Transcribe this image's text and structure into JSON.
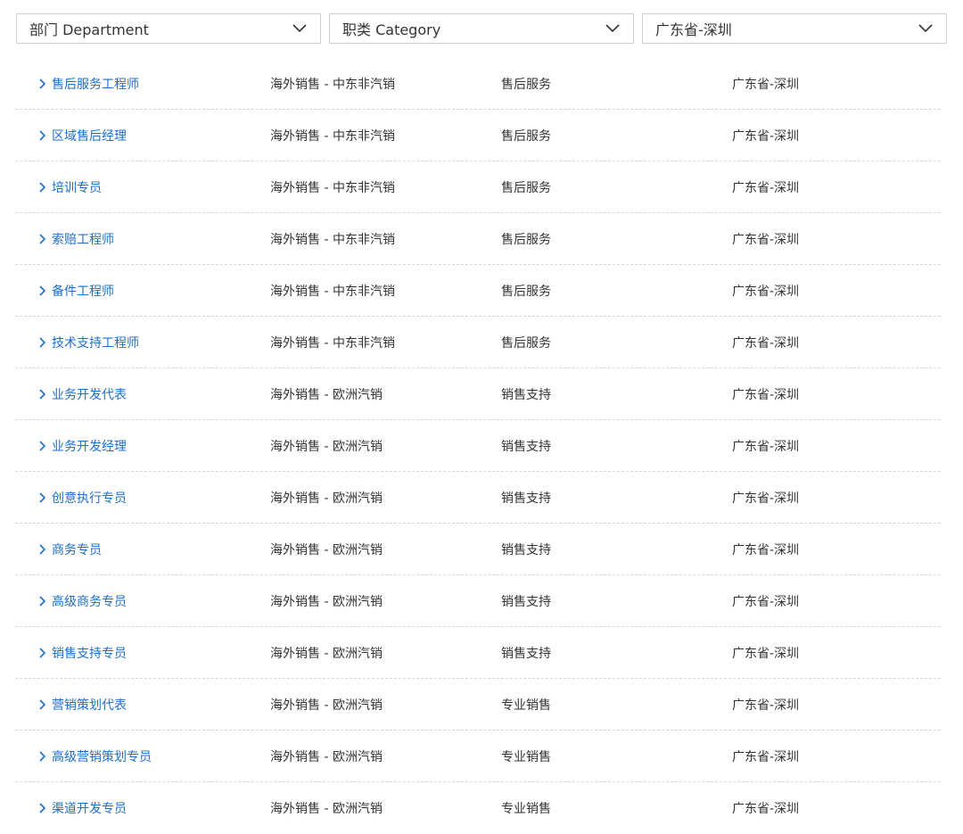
{
  "filters": {
    "department": "部门 Department",
    "category": "职类 Category",
    "location": "广东省-深圳"
  },
  "jobs": [
    {
      "title": "售后服务工程师",
      "dept": "海外销售 - 中东非汽销",
      "category": "售后服务",
      "location": "广东省-深圳"
    },
    {
      "title": "区域售后经理",
      "dept": "海外销售 - 中东非汽销",
      "category": "售后服务",
      "location": "广东省-深圳"
    },
    {
      "title": "培训专员",
      "dept": "海外销售 - 中东非汽销",
      "category": "售后服务",
      "location": "广东省-深圳"
    },
    {
      "title": "索赔工程师",
      "dept": "海外销售 - 中东非汽销",
      "category": "售后服务",
      "location": "广东省-深圳"
    },
    {
      "title": "备件工程师",
      "dept": "海外销售 - 中东非汽销",
      "category": "售后服务",
      "location": "广东省-深圳"
    },
    {
      "title": "技术支持工程师",
      "dept": "海外销售 - 中东非汽销",
      "category": "售后服务",
      "location": "广东省-深圳"
    },
    {
      "title": "业务开发代表",
      "dept": "海外销售 - 欧洲汽销",
      "category": "销售支持",
      "location": "广东省-深圳"
    },
    {
      "title": "业务开发经理",
      "dept": "海外销售 - 欧洲汽销",
      "category": "销售支持",
      "location": "广东省-深圳"
    },
    {
      "title": "创意执行专员",
      "dept": "海外销售 - 欧洲汽销",
      "category": "销售支持",
      "location": "广东省-深圳"
    },
    {
      "title": "商务专员",
      "dept": "海外销售 - 欧洲汽销",
      "category": "销售支持",
      "location": "广东省-深圳"
    },
    {
      "title": "高级商务专员",
      "dept": "海外销售 - 欧洲汽销",
      "category": "销售支持",
      "location": "广东省-深圳"
    },
    {
      "title": "销售支持专员",
      "dept": "海外销售 - 欧洲汽销",
      "category": "销售支持",
      "location": "广东省-深圳"
    },
    {
      "title": "营销策划代表",
      "dept": "海外销售 - 欧洲汽销",
      "category": "专业销售",
      "location": "广东省-深圳"
    },
    {
      "title": "高级营销策划专员",
      "dept": "海外销售 - 欧洲汽销",
      "category": "专业销售",
      "location": "广东省-深圳"
    },
    {
      "title": "渠道开发专员",
      "dept": "海外销售 - 欧洲汽销",
      "category": "专业销售",
      "location": "广东省-深圳"
    }
  ],
  "icons": {
    "select_arrow": "chevron-down-icon",
    "row_arrow": "chevron-right-icon"
  },
  "colors": {
    "link": "#1e6fc4",
    "text": "#333333",
    "border": "#cfcfcf",
    "divider": "#d6d6d6"
  }
}
